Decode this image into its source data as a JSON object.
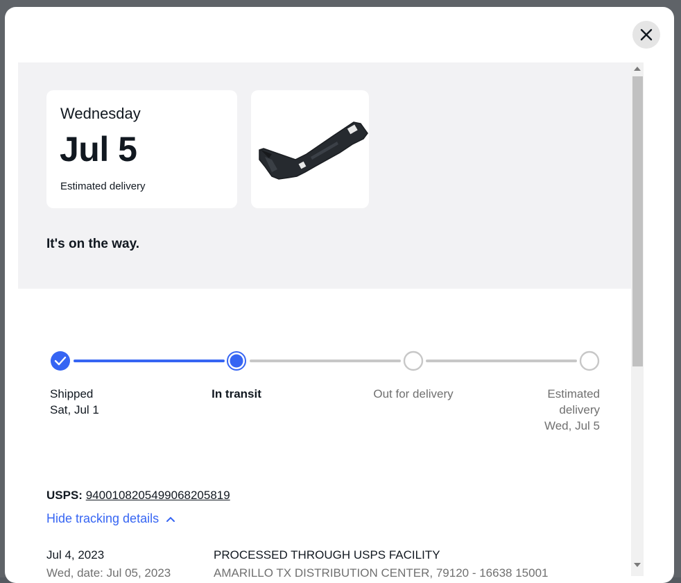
{
  "delivery": {
    "weekday": "Wednesday",
    "date": "Jul 5",
    "label": "Estimated delivery"
  },
  "item": {
    "image_alt": "black plastic bumper bracket"
  },
  "status_text": "It's on the way.",
  "progress": {
    "current_step": 1,
    "accent": "#3665f3",
    "steps": [
      {
        "label": "Shipped",
        "sub": "Sat, Jul 1",
        "state": "done"
      },
      {
        "label": "In transit",
        "sub": "",
        "state": "current"
      },
      {
        "label": "Out for delivery",
        "sub": "",
        "state": "pending"
      },
      {
        "label": "Estimated delivery",
        "sub": "Wed, Jul 5",
        "state": "pending"
      }
    ]
  },
  "tracking": {
    "carrier": "USPS:",
    "number": "9400108205499068205819",
    "toggle_label": "Hide tracking details"
  },
  "events": [
    {
      "date": "Jul 4, 2023",
      "date_sub": "Wed, date: Jul 05, 2023",
      "description": "PROCESSED THROUGH USPS FACILITY",
      "location": "AMARILLO TX DISTRIBUTION CENTER, 79120 - 16638 15001"
    }
  ],
  "colors": {
    "brand_blue": "#3665f3",
    "hero_bg": "#f2f2f4",
    "track_gray": "#c7c7c7"
  }
}
